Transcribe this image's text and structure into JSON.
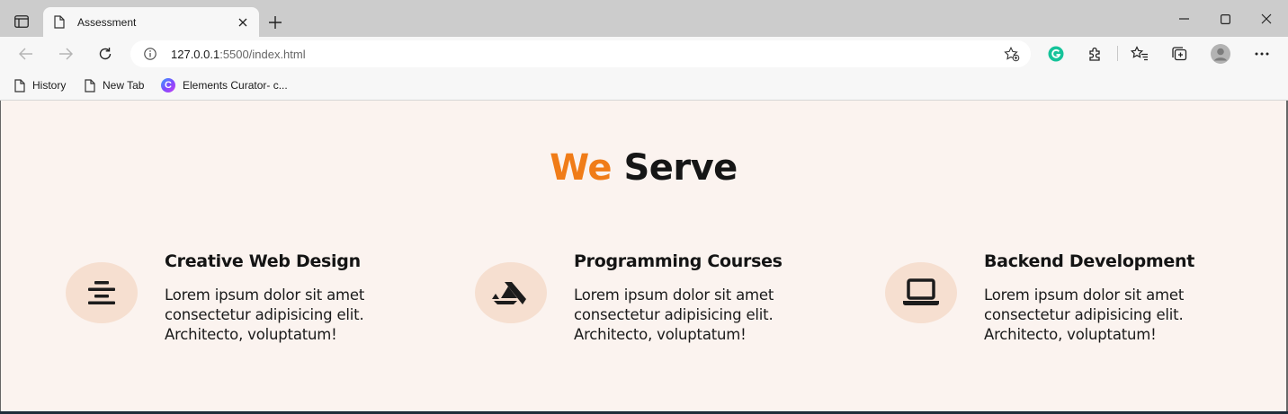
{
  "browser": {
    "tab_title": "Assessment",
    "url_host": "127.0.0.1",
    "url_rest": ":5500/index.html",
    "favorites": [
      {
        "label": "History",
        "icon": "page-icon"
      },
      {
        "label": "New Tab",
        "icon": "page-icon"
      },
      {
        "label": "Elements Curator- c...",
        "icon": "curator-icon"
      }
    ]
  },
  "page": {
    "heading_accent": "We",
    "heading_main": "Serve",
    "services": [
      {
        "title": "Creative Web Design",
        "text": "Lorem ipsum dolor sit amet consectetur adipisicing elit. Architecto, voluptatum!",
        "icon": "align-center-icon"
      },
      {
        "title": "Programming Courses",
        "text": "Lorem ipsum dolor sit amet consectetur adipisicing elit. Architecto, voluptatum!",
        "icon": "artstation-icon"
      },
      {
        "title": "Backend Development",
        "text": "Lorem ipsum dolor sit amet consectetur adipisicing elit. Architecto, voluptatum!",
        "icon": "laptop-icon"
      }
    ]
  },
  "colors": {
    "accent": "#f07c18",
    "page_bg": "#fbf3ef",
    "icon_circle": "#f6dfd0"
  }
}
